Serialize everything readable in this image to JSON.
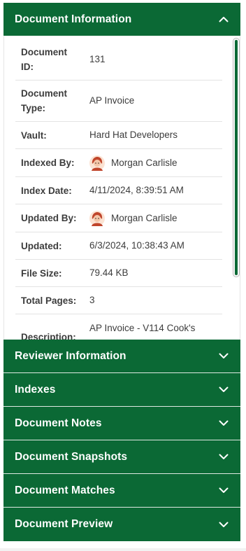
{
  "sections": {
    "document_information": {
      "label": "Document Information",
      "state": "expanded",
      "icon": "chevron-up-icon"
    },
    "collapsed": [
      {
        "label": "Reviewer Information",
        "icon": "chevron-down-icon"
      },
      {
        "label": "Indexes",
        "icon": "chevron-down-icon"
      },
      {
        "label": "Document Notes",
        "icon": "chevron-down-icon"
      },
      {
        "label": "Document Snapshots",
        "icon": "chevron-down-icon"
      },
      {
        "label": "Document Matches",
        "icon": "chevron-down-icon"
      },
      {
        "label": "Document Preview",
        "icon": "chevron-down-icon"
      }
    ]
  },
  "info": {
    "document_id": {
      "label": "Document ID:",
      "value": "131"
    },
    "document_type": {
      "label": "Document Type:",
      "value": "AP Invoice"
    },
    "vault": {
      "label": "Vault:",
      "value": "Hard Hat Developers"
    },
    "indexed_by": {
      "label": "Indexed By:",
      "value": "Morgan Carlisle"
    },
    "index_date": {
      "label": "Index Date:",
      "value": "4/11/2024, 8:39:51 AM"
    },
    "updated_by": {
      "label": "Updated By:",
      "value": "Morgan Carlisle"
    },
    "updated": {
      "label": "Updated:",
      "value": "6/3/2024, 10:38:43 AM"
    },
    "file_size": {
      "label": "File Size:",
      "value": "79.44 KB"
    },
    "total_pages": {
      "label": "Total Pages:",
      "value": "3"
    },
    "description": {
      "label": "Description:",
      "value": "AP Invoice - V114 Cook's"
    }
  },
  "colors": {
    "header_green": "#0b6935",
    "text": "#3c3c3c"
  }
}
